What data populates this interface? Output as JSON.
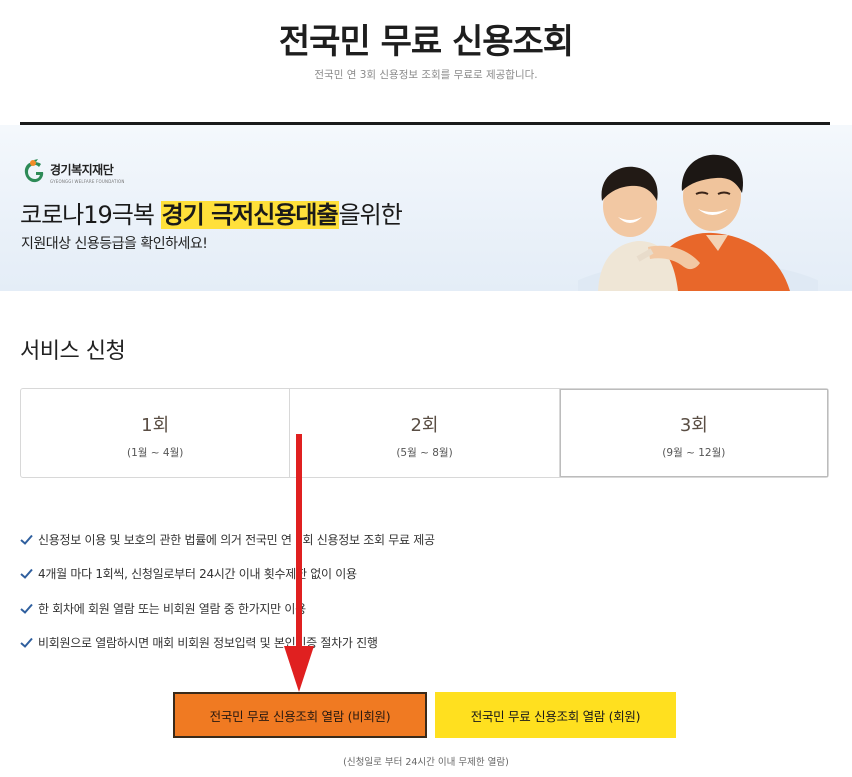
{
  "header": {
    "title": "전국민 무료 신용조회",
    "subtitle": "전국민 연 3회 신용정보 조회를 무료로 제공합니다."
  },
  "banner": {
    "logo_name": "경기복지재단",
    "logo_english": "GYEONGGI WELFARE FOUNDATION",
    "headline_prefix": "코로나19극복 ",
    "headline_highlight": "경기 극저신용대출",
    "headline_suffix": "을위한",
    "description": "지원대상 신용등급을 확인하세요!"
  },
  "service": {
    "title": "서비스 신청",
    "rounds": [
      {
        "label": "1회",
        "period": "(1월 ~ 4월)"
      },
      {
        "label": "2회",
        "period": "(5월 ~ 8월)"
      },
      {
        "label": "3회",
        "period": "(9월 ~ 12월)"
      }
    ],
    "active_round": 2
  },
  "notices": [
    "신용정보 이용 및 보호의 관한 법률에 의거 전국민 연 3회 신용정보 조회 무료 제공",
    "4개월 마다 1회씩, 신청일로부터 24시간 이내 횟수제한 없이 이용",
    "한 회차에 회원 열람 또는 비회원 열람 중 한가지만 이용",
    "비회원으로 열람하시면 매회 비회원 정보입력 및 본인인증 절차가 진행"
  ],
  "actions": {
    "guest_button": "전국민 무료 신용조회 열람 (비회원)",
    "member_button": "전국민 무료 신용조회 열람 (회원)",
    "note": "(신청일로 부터 24시간 이내 무제한 열람)"
  },
  "icons": {
    "check": "check-icon",
    "logo": "foundation-logo-icon",
    "annotation": "red-arrow-icon"
  },
  "colors": {
    "guest_button": "#f07a22",
    "member_button": "#ffe01f",
    "highlight": "#ffe03a",
    "check": "#2f5f9e",
    "arrow": "#e02020"
  }
}
